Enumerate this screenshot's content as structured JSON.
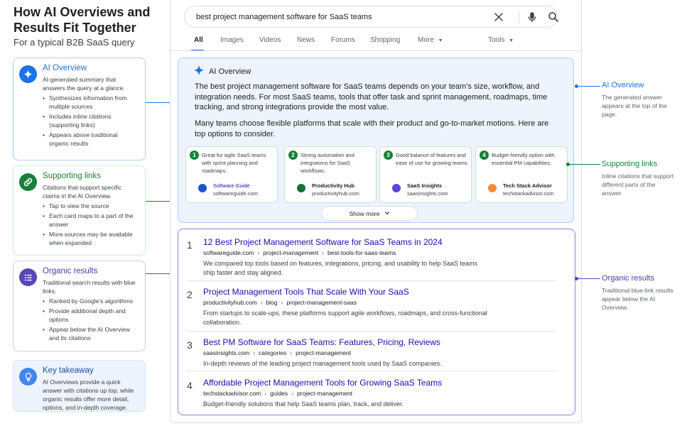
{
  "header": {
    "title": "How AI Overviews and Results Fit Together",
    "subtitle": "For a typical B2B SaaS query"
  },
  "legend": {
    "ai_overview": {
      "title": "AI Overview",
      "description": "AI-generated summary that answers the query at a glance.",
      "bullets": [
        "Synthesizes information from multiple sources",
        "Includes inline citations (supporting links)",
        "Appears above traditional organic results"
      ]
    },
    "supporting_links": {
      "title": "Supporting links",
      "description": "Citations that support specific claims in the AI Overview.",
      "bullets": [
        "Tap to view the source",
        "Each card maps to a part of the answer",
        "More sources may be available when expanded"
      ]
    },
    "organic_results": {
      "title": "Organic results",
      "description": "Traditional search results with blue links.",
      "bullets": [
        "Ranked by Google’s algorithms",
        "Provide additional depth and options",
        "Appear below the AI Overview and its citations"
      ]
    },
    "key_takeaway": {
      "title": "Key takeaway",
      "description": "AI Overviews provide a quick answer with citations up top, while organic results offer more detail, options, and in-depth coverage."
    }
  },
  "search": {
    "query": "best project management software for SaaS teams",
    "tabs": [
      "All",
      "Images",
      "Videos",
      "News",
      "Forums",
      "Shopping",
      "More",
      "Tools"
    ],
    "active_tab": "All"
  },
  "ai_overview": {
    "label": "AI Overview",
    "paragraph1": "The best project management software for SaaS teams depends on your team’s size, workflow, and integration needs. For most SaaS teams, tools that offer task and sprint management, roadmaps, time tracking, and strong integrations provide the most value.",
    "paragraph2": "Many teams choose flexible platforms that scale with their product and go-to-market motions. Here are top options to consider.",
    "citations": [
      {
        "num": "1",
        "text": "Great for agile SaaS teams with sprint planning and roadmaps.",
        "source": "Software Guide",
        "domain": "softwareguide.com",
        "color": "#1a56c8"
      },
      {
        "num": "2",
        "text": "Strong automation and integrations for SaaS workflows.",
        "source": "Productivity Hub",
        "domain": "productivityhub.com",
        "color": "#137333"
      },
      {
        "num": "3",
        "text": "Good balance of features and ease of use for growing teams.",
        "source": "SaaS Insights",
        "domain": "saasinsights.com",
        "color": "#5b46d6"
      },
      {
        "num": "4",
        "text": "Budget-friendly option with essential PM capabilities.",
        "source": "Tech Stack Advisor",
        "domain": "techstackadvisor.com",
        "color": "#f28b3c"
      }
    ],
    "show_more": "Show more"
  },
  "organic_results": [
    {
      "num": "1",
      "title": "12 Best Project Management Software for SaaS Teams in 2024",
      "url": [
        "softwareguide.com",
        "project-management",
        "best-tools-for-saas-teams"
      ],
      "snippet": "We compared top tools based on features, integrations, pricing, and usability to help SaaS teams ship faster and stay aligned."
    },
    {
      "num": "2",
      "title": "Project Management Tools That Scale With Your SaaS",
      "url": [
        "productivityhub.com",
        "blog",
        "project-management-saas"
      ],
      "snippet": "From startups to scale-ups, these platforms support agile workflows, roadmaps, and cross-functional collaboration."
    },
    {
      "num": "3",
      "title": "Best PM Software for SaaS Teams: Features, Pricing, Reviews",
      "url": [
        "saasinsights.com",
        "categories",
        "project-management"
      ],
      "snippet": "In-depth reviews of the leading project management tools used by SaaS companies."
    },
    {
      "num": "4",
      "title": "Affordable Project Management Tools for Growing SaaS Teams",
      "url": [
        "techstackadvisor.com",
        "guides",
        "project-management"
      ],
      "snippet": "Budget-friendly solutions that help SaaS teams plan, track, and deliver."
    }
  ],
  "annotations": {
    "ai_overview": {
      "title": "AI Overview",
      "description": "The generated answer appears at the top of the page."
    },
    "supporting_links": {
      "title": "Supporting links",
      "description": "Inline citations that support different parts of the answer."
    },
    "organic_results": {
      "title": "Organic results",
      "description": "Traditional blue-link results appear below the AI Overview."
    }
  },
  "colors": {
    "ai_blue": "#1a73e8",
    "support_green": "#188038",
    "organic_purple": "#5b46b6",
    "link_blue": "#1a0dab"
  }
}
